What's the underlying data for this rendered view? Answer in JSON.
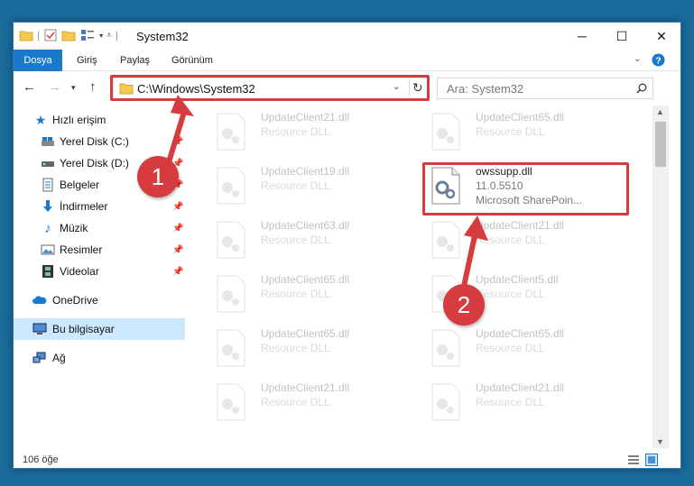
{
  "window": {
    "title": "System32",
    "controls": {
      "minimize": "─",
      "maximize": "☐",
      "close": "✕"
    }
  },
  "menu": {
    "file": "Dosya",
    "home": "Giriş",
    "share": "Paylaş",
    "view": "Görünüm"
  },
  "address": {
    "path": "C:\\Windows\\System32"
  },
  "search": {
    "placeholder": "Ara: System32"
  },
  "sidebar": {
    "items": [
      {
        "label": "Hızlı erişim"
      },
      {
        "label": "Yerel Disk (C:)"
      },
      {
        "label": "Yerel Disk (D:)"
      },
      {
        "label": "Belgeler"
      },
      {
        "label": "İndirmeler"
      },
      {
        "label": "Müzik"
      },
      {
        "label": "Resimler"
      },
      {
        "label": "Videolar"
      },
      {
        "label": "OneDrive"
      },
      {
        "label": "Bu bilgisayar"
      },
      {
        "label": "Ağ"
      }
    ]
  },
  "files": {
    "left": [
      {
        "name": "UpdateClient21.dll",
        "line1": "Resource DLL"
      },
      {
        "name": "UpdateClient19.dll",
        "line1": "Resource DLL"
      },
      {
        "name": "UpdateClient63.dll",
        "line1": "Resource DLL"
      },
      {
        "name": "UpdateClient65.dll",
        "line1": "Resource DLL"
      },
      {
        "name": "UpdateClient65.dll",
        "line1": "Resource DLL"
      },
      {
        "name": "UpdateClient21.dll",
        "line1": "Resource DLL"
      }
    ],
    "right": [
      {
        "name": "UpdateClient65.dll",
        "line1": "Resource DLL"
      },
      {
        "name": "owssupp.dll",
        "line1": "11.0.5510",
        "line2": "Microsoft SharePoin..."
      },
      {
        "name": "UpdateClient21.dll",
        "line1": "Resource DLL"
      },
      {
        "name": "UpdateClient5.dll",
        "line1": "Resource DLL"
      },
      {
        "name": "UpdateClient65.dll",
        "line1": "Resource DLL"
      },
      {
        "name": "UpdateClient21.dll",
        "line1": "Resource DLL"
      }
    ]
  },
  "status": {
    "count": "106 öğe"
  },
  "callouts": {
    "one": "1",
    "two": "2"
  },
  "colors": {
    "accent": "#1979ca",
    "highlight": "#d63b3f",
    "selected": "#cce8ff"
  }
}
